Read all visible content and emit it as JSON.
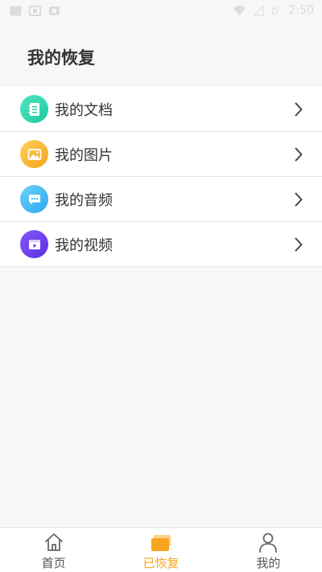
{
  "status_bar": {
    "time": "2:50"
  },
  "header": {
    "title": "我的恢复"
  },
  "menu": {
    "items": [
      {
        "label": "我的文档",
        "icon": "document-icon",
        "color": "#2fd8b0"
      },
      {
        "label": "我的图片",
        "icon": "image-icon",
        "color": "#f7b52a"
      },
      {
        "label": "我的音频",
        "icon": "audio-icon",
        "color": "#3fb6f2"
      },
      {
        "label": "我的视频",
        "icon": "video-icon",
        "color": "#6a3ef0"
      }
    ]
  },
  "bottom_nav": {
    "tabs": [
      {
        "label": "首页",
        "icon": "home-icon",
        "active": false
      },
      {
        "label": "已恢复",
        "icon": "recovered-icon",
        "active": true
      },
      {
        "label": "我的",
        "icon": "user-icon",
        "active": false
      }
    ]
  },
  "colors": {
    "accent": "#f7a51e",
    "background": "#f7f7f7"
  }
}
